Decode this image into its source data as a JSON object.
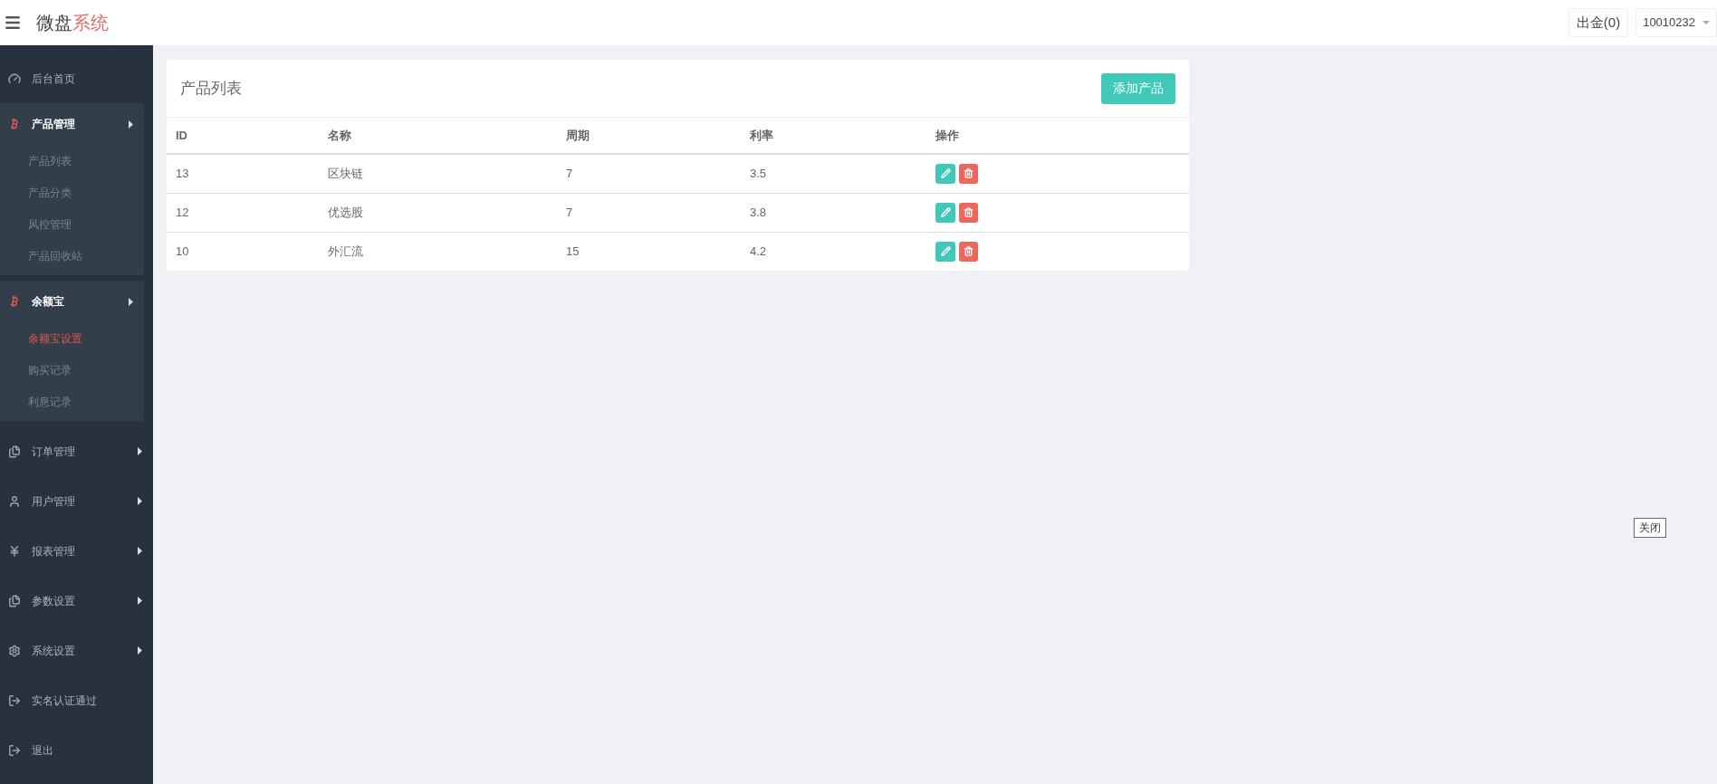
{
  "header": {
    "title_part1": "微盘",
    "title_part2": "系统",
    "withdraw_button": "出金(0)",
    "user_menu": "10010232"
  },
  "sidebar": {
    "items": [
      {
        "kind": "link",
        "label": "后台首页"
      },
      {
        "kind": "group",
        "label": "产品管理",
        "expanded": true,
        "children": [
          {
            "label": "产品列表",
            "selected": false
          },
          {
            "label": "产品分类",
            "selected": false
          },
          {
            "label": "风控管理",
            "selected": false
          },
          {
            "label": "产品回收站",
            "selected": false
          }
        ]
      },
      {
        "kind": "group",
        "label": "余额宝",
        "expanded": true,
        "children": [
          {
            "label": "余额宝设置",
            "selected": true
          },
          {
            "label": "购买记录",
            "selected": false
          },
          {
            "label": "利息记录",
            "selected": false
          }
        ]
      },
      {
        "kind": "group",
        "label": "订单管理",
        "expanded": false
      },
      {
        "kind": "group",
        "label": "用户管理",
        "expanded": false
      },
      {
        "kind": "group",
        "label": "报表管理",
        "expanded": false
      },
      {
        "kind": "group",
        "label": "参数设置",
        "expanded": false
      },
      {
        "kind": "group",
        "label": "系统设置",
        "expanded": false
      },
      {
        "kind": "link",
        "label": "实名认证通过"
      },
      {
        "kind": "link",
        "label": "退出"
      }
    ]
  },
  "card": {
    "title": "产品列表",
    "add_button": "添加产品",
    "table": {
      "columns": [
        "ID",
        "名称",
        "周期",
        "利率",
        "操作"
      ],
      "rows": [
        {
          "id": "13",
          "name": "区块链",
          "period": "7",
          "rate": "3.5"
        },
        {
          "id": "12",
          "name": "优选股",
          "period": "7",
          "rate": "3.8"
        },
        {
          "id": "10",
          "name": "外汇流",
          "period": "15",
          "rate": "4.2"
        }
      ]
    }
  },
  "close_button": "关闭"
}
